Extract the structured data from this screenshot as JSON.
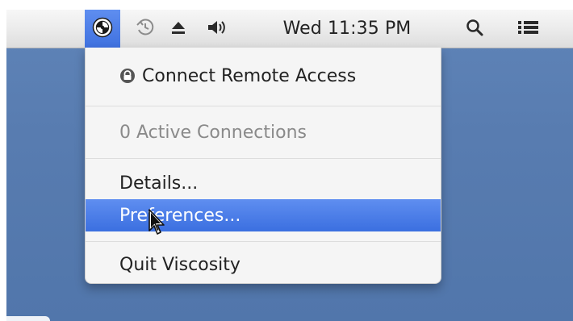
{
  "menubar": {
    "time": "Wed 11:35 PM"
  },
  "menu": {
    "connect_label": "Connect Remote Access",
    "active_connections": "0 Active Connections",
    "details_label": "Details...",
    "preferences_label": "Preferences...",
    "quit_label": "Quit Viscosity"
  },
  "icons": {
    "app_icon": "viscosity-icon",
    "time_machine": "time-machine-icon",
    "eject": "eject-icon",
    "volume": "volume-icon",
    "search": "search-icon",
    "list": "list-icon",
    "lock": "lock-icon",
    "cursor": "cursor-icon"
  },
  "colors": {
    "desktop": "#5b7fb3",
    "selection": "#3f71df",
    "menu_bg": "#f5f5f5"
  }
}
